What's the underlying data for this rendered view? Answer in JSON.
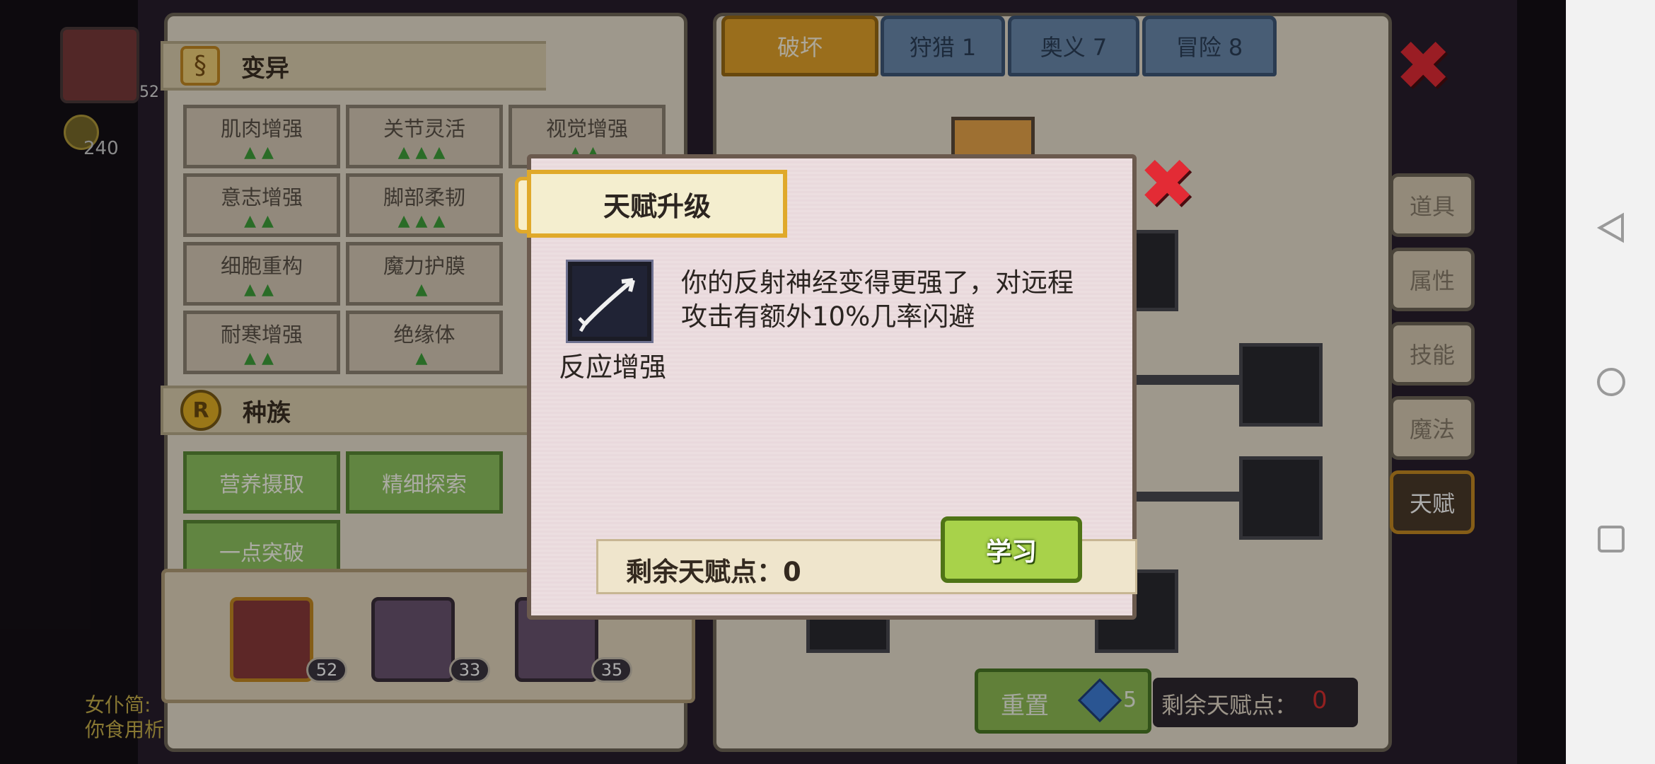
{
  "left_panel": {
    "mutation_section": {
      "title": "变异",
      "traits": [
        {
          "label": "肌肉增强",
          "level": "▲▲"
        },
        {
          "label": "关节灵活",
          "level": "▲▲▲"
        },
        {
          "label": "视觉增强",
          "level": "▲▲"
        },
        {
          "label": "意志增强",
          "level": "▲▲"
        },
        {
          "label": "脚部柔韧",
          "level": "▲▲▲"
        },
        {
          "label": "细胞重构",
          "level": "▲▲"
        },
        {
          "label": "魔力护膜",
          "level": "▲"
        },
        {
          "label": "耐寒增强",
          "level": "▲▲"
        },
        {
          "label": "绝缘体",
          "level": "▲"
        }
      ]
    },
    "race_section": {
      "title": "种族",
      "badge": "R",
      "traits": [
        "营养摄取",
        "精细探索",
        "一点突破"
      ]
    },
    "heroes": [
      {
        "level": "52"
      },
      {
        "level": "33"
      },
      {
        "level": "35"
      }
    ]
  },
  "hud": {
    "player_level": "52",
    "currency": "240",
    "chat_line1": "女仆简:",
    "chat_line2": "你食用析"
  },
  "right_panel": {
    "tabs": [
      {
        "label": "破坏",
        "active": true
      },
      {
        "label": "狩猎 1",
        "active": false
      },
      {
        "label": "奥义 7",
        "active": false
      },
      {
        "label": "冒险 8",
        "active": false
      }
    ],
    "side_tabs": [
      {
        "label": "道具"
      },
      {
        "label": "属性"
      },
      {
        "label": "技能"
      },
      {
        "label": "魔法"
      },
      {
        "label": "天赋",
        "active": true
      }
    ],
    "reset_label": "重置",
    "reset_cost": "5",
    "remaining_label": "剩余天赋点：",
    "remaining_value": "0"
  },
  "dialog": {
    "title": "天赋升级",
    "skill_name": "反应增强",
    "description": "你的反射神经变得更强了，对远程攻击有额外10%几率闪避",
    "points_label": "剩余天赋点：0",
    "learn_label": "学习",
    "close_symbol": "✖"
  },
  "colors": {
    "accent_gold": "#e3a32a",
    "learn_green": "#a8d24a",
    "close_red": "#e32b35",
    "remaining_red": "#d83030"
  }
}
